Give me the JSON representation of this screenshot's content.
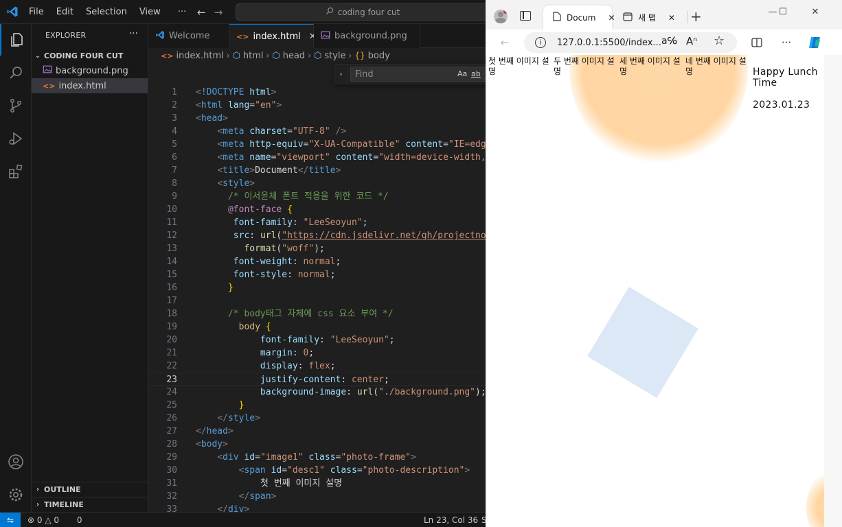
{
  "vscode": {
    "menu": [
      "File",
      "Edit",
      "Selection",
      "View",
      "···"
    ],
    "command_center": "coding four cut",
    "sidebar": {
      "title": "EXPLORER",
      "more": "···",
      "folder": "CODING FOUR CUT",
      "files": [
        {
          "name": "background.png",
          "icon": "image-file-icon"
        },
        {
          "name": "index.html",
          "icon": "html-file-icon"
        }
      ],
      "sections": [
        "OUTLINE",
        "TIMELINE"
      ]
    },
    "tabs": [
      {
        "label": "Welcome",
        "icon": "vscode-icon"
      },
      {
        "label": "index.html",
        "icon": "html-file-icon"
      },
      {
        "label": "background.png",
        "icon": "image-file-icon"
      }
    ],
    "breadcrumb": [
      "index.html",
      "html",
      "head",
      "style",
      "body"
    ],
    "find": {
      "placeholder": "Find",
      "match_case": "Aa",
      "whole_word": "ab"
    },
    "code_lines": [
      "1",
      "2",
      "3",
      "4",
      "5",
      "6",
      "7",
      "8",
      "9",
      "10",
      "11",
      "12",
      "13",
      "14",
      "15",
      "16",
      "17",
      "18",
      "19",
      "20",
      "21",
      "22",
      "23",
      "24",
      "25",
      "26",
      "27",
      "28",
      "29",
      "30",
      "31",
      "32",
      "33"
    ],
    "current_line": 23,
    "status": {
      "errors": "0",
      "warnings": "0",
      "ports": "0",
      "position": "Ln 23, Col 36",
      "spaces": "S"
    }
  },
  "browser": {
    "tabs": [
      {
        "label": "Docum",
        "icon": "page-icon"
      },
      {
        "label": "새 탭",
        "icon": "new-tab-icon"
      }
    ],
    "address": "127.0.0.1:5500/index...",
    "page": {
      "descriptions": [
        "첫 번째 이미지 설명",
        "두 번째 이미지 설명",
        "세 번째 이미지 설명",
        "네 번째 이미지 설명"
      ],
      "title": "Happy Lunch Time",
      "date": "2023.01.23"
    }
  },
  "colors": {
    "accent": "#0078d4",
    "background_blob": "#ffd6a3",
    "background_square": "#dce8f6"
  }
}
